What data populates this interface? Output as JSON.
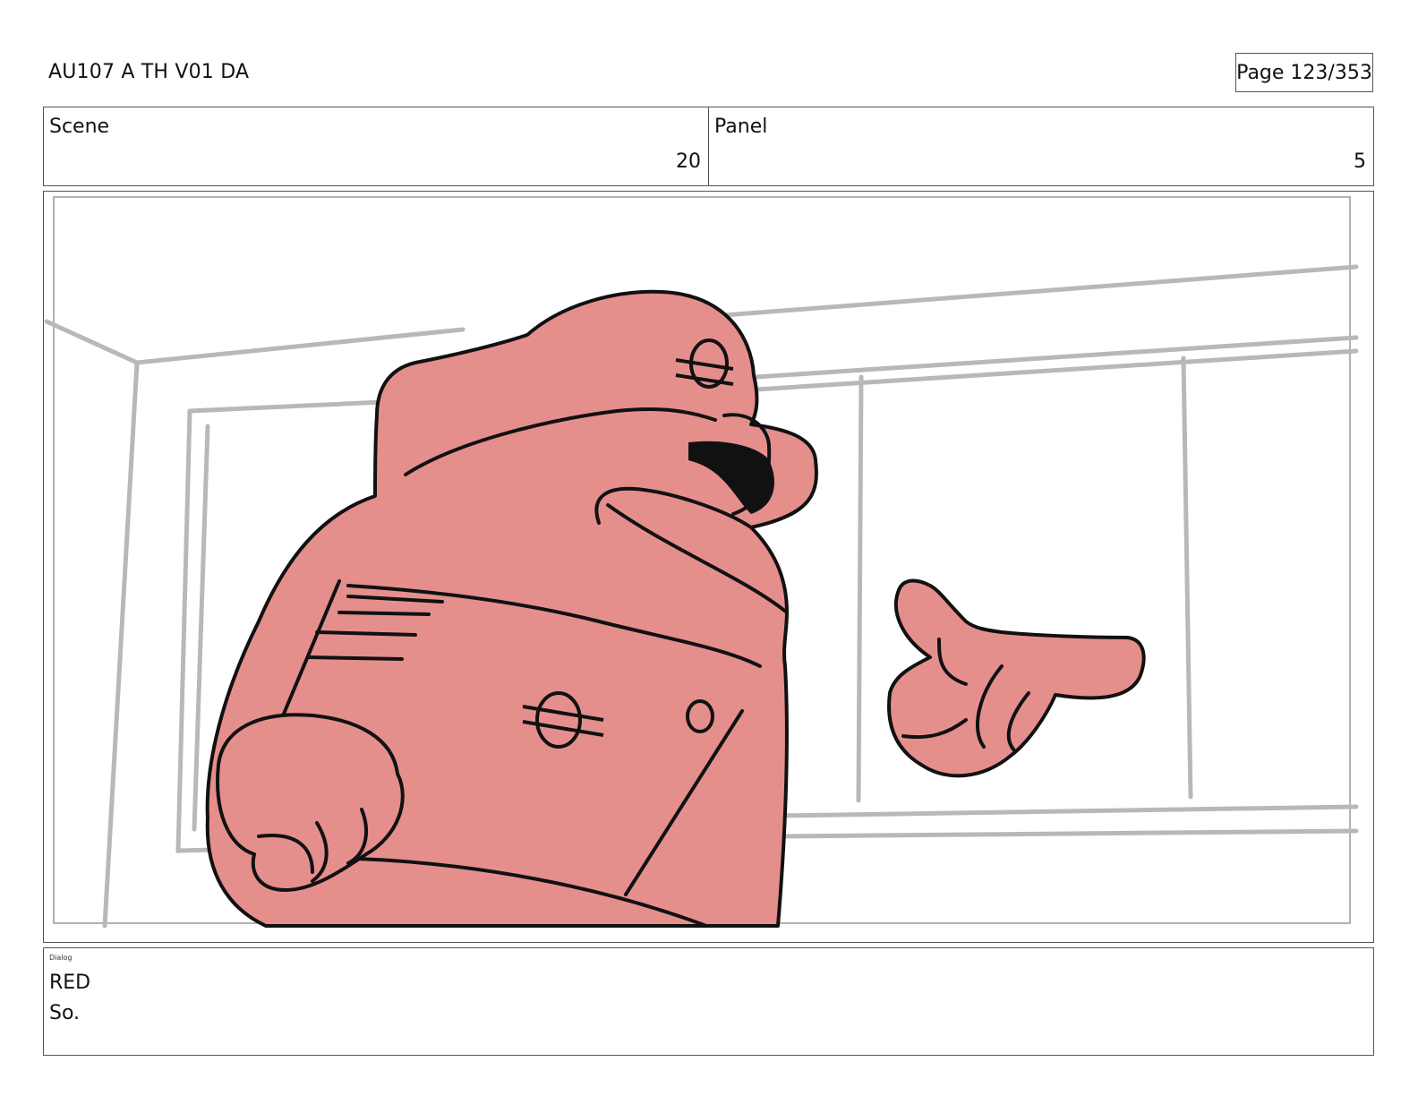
{
  "header": {
    "doc_title": "AU107 A TH V01 DA",
    "page_label": "Page 123/353"
  },
  "info": {
    "scene_label": "Scene",
    "scene_value": "20",
    "panel_label": "Panel",
    "panel_value": "5"
  },
  "artwork": {
    "subject": "character-pointing",
    "fill_color": "#e58f8d",
    "line_color": "#111111",
    "background_line_color": "#b8b8b8"
  },
  "dialog": {
    "label": "Dialog",
    "speaker": "RED",
    "line": "So."
  }
}
